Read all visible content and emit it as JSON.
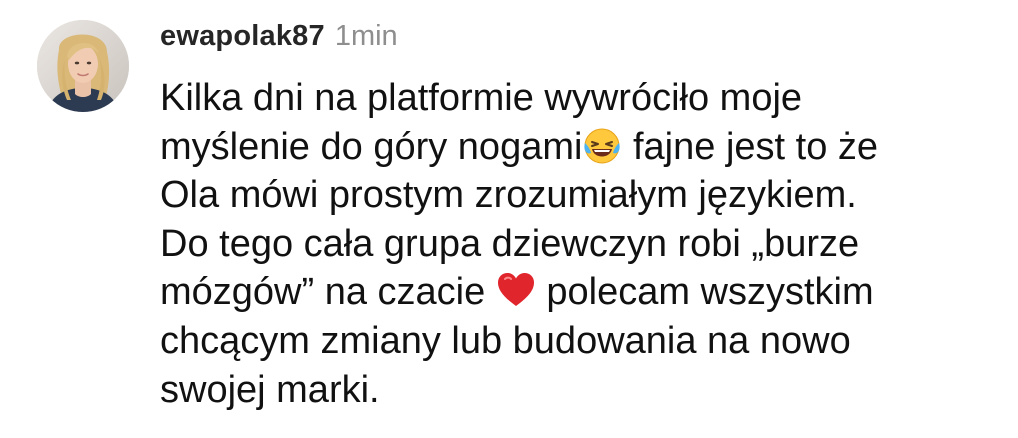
{
  "comment": {
    "username": "ewapolak87",
    "timestamp": "1min",
    "lines": [
      [
        "Kilka dni na platformie wywróciło moje"
      ],
      [
        "myślenie do góry nogami",
        " fajne jest to że"
      ],
      [
        "Ola mówi prostym zrozumiałym językiem."
      ],
      [
        "Do tego cała grupa dziewczyn robi „burze"
      ],
      [
        "mózgów” na czacie ",
        " polecam wszystkim"
      ],
      [
        "chcącym zmiany lub budowania na nowo"
      ],
      [
        "swojej marki."
      ]
    ],
    "emojis": {
      "laughing": "face-with-tears-of-joy-icon",
      "heart": "red-heart-icon"
    }
  },
  "colors": {
    "username": "#262626",
    "timestamp": "#8e8e8e",
    "text": "#111111",
    "heart": "#e0262c",
    "emoji_face": "#ffc83d"
  }
}
